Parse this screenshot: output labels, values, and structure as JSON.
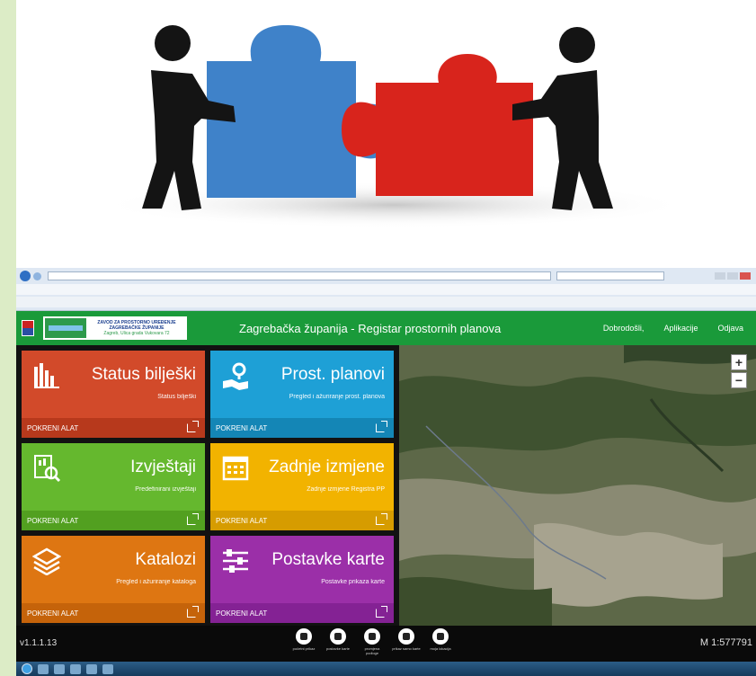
{
  "header": {
    "logo_lines": [
      "ZAVOD ZA PROSTORNO UREĐENJE",
      "ZAGREBAČKE ŽUPANIJE",
      "Zagreb, Ulica grada Vukovara 72"
    ],
    "title": "Zagrebačka županija - Registar prostornih planova",
    "nav": {
      "welcome": "Dobrodošli,",
      "apps": "Aplikacije",
      "logout": "Odjava"
    }
  },
  "tiles": [
    {
      "title": "Status bilješki",
      "subtitle": "Status bilješki",
      "action": "POKRENI ALAT",
      "color": "#d24a2a",
      "foot_color": "#b7391c",
      "icon": "bar-chart-icon"
    },
    {
      "title": "Prost. planovi",
      "subtitle": "Pregled i ažuriranje prost. planova",
      "action": "POKRENI ALAT",
      "color": "#1ea0d6",
      "foot_color": "#1486b6",
      "icon": "map-pin-icon"
    },
    {
      "title": "Izvještaji",
      "subtitle": "Predefinirani izvještaji",
      "action": "POKRENI ALAT",
      "color": "#65b82e",
      "foot_color": "#52a020",
      "icon": "report-search-icon"
    },
    {
      "title": "Zadnje izmjene",
      "subtitle": "Zadnje izmjene Registra PP",
      "action": "POKRENI ALAT",
      "color": "#f2b300",
      "foot_color": "#d69c00",
      "icon": "calendar-icon"
    },
    {
      "title": "Katalozi",
      "subtitle": "Pregled i ažuriranje kataloga",
      "action": "POKRENI ALAT",
      "color": "#de7612",
      "foot_color": "#c5630a",
      "icon": "layers-icon"
    },
    {
      "title": "Postavke karte",
      "subtitle": "Postavke prikaza karte",
      "action": "POKRENI ALAT",
      "color": "#9b2fa8",
      "foot_color": "#842294",
      "icon": "sliders-icon"
    }
  ],
  "map": {
    "zoom_in": "+",
    "zoom_out": "−"
  },
  "footer": {
    "version": "v1.1.1.13",
    "scale": "M 1:577791",
    "tools": [
      {
        "label": "početni prikaz",
        "icon": "home-icon"
      },
      {
        "label": "postavke karte",
        "icon": "menu-icon"
      },
      {
        "label": "promjena podloge",
        "icon": "globe-icon"
      },
      {
        "label": "prikaz samo karte",
        "icon": "map-icon"
      },
      {
        "label": "moja lokacija",
        "icon": "target-icon"
      }
    ]
  }
}
